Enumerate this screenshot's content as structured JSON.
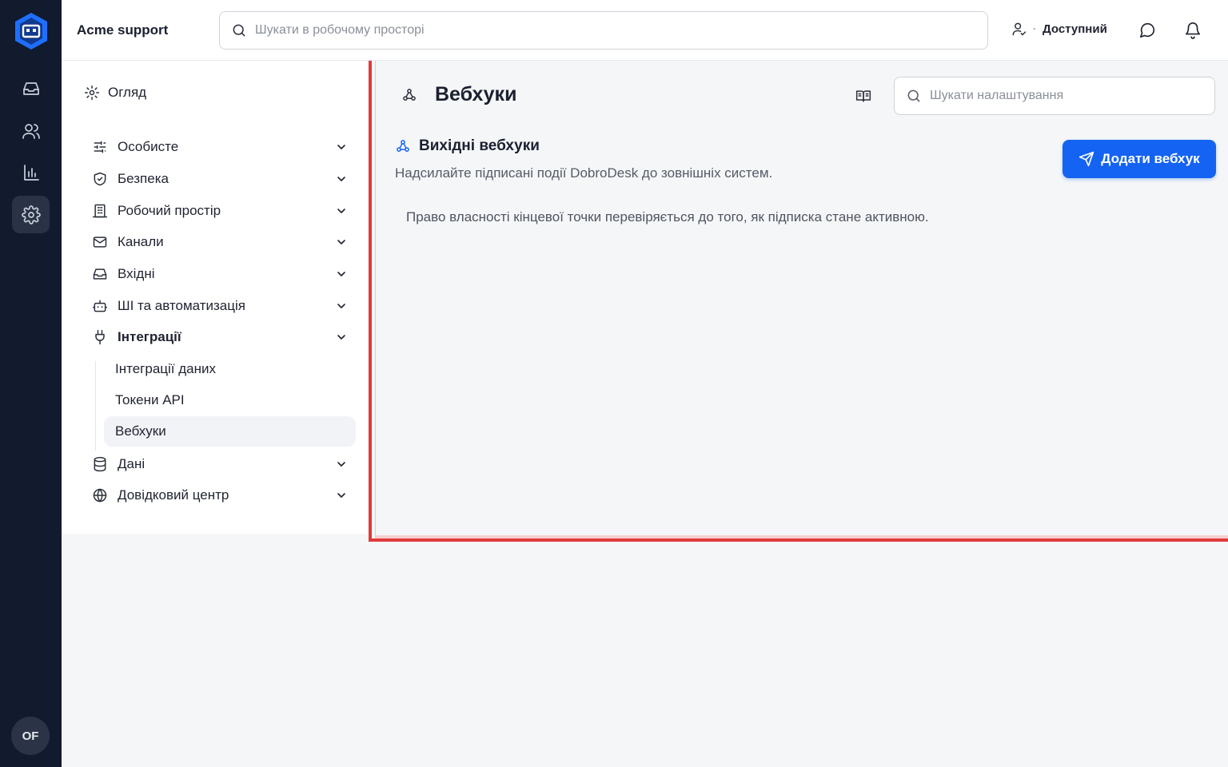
{
  "brand": "Acme support",
  "global_search": {
    "placeholder": "Шукати в робочому просторі"
  },
  "status": {
    "label": "Доступний"
  },
  "user": {
    "initials": "OF"
  },
  "settings_nav": {
    "overview": "Огляд",
    "groups": [
      {
        "label": "Особисте",
        "icon": "sliders-icon"
      },
      {
        "label": "Безпека",
        "icon": "shield-icon"
      },
      {
        "label": "Робочий простір",
        "icon": "building-icon"
      },
      {
        "label": "Канали",
        "icon": "mail-icon"
      },
      {
        "label": "Вхідні",
        "icon": "inbox-icon"
      },
      {
        "label": "ШІ та автоматизація",
        "icon": "bot-icon"
      },
      {
        "label": "Інтеграції",
        "icon": "plug-icon"
      },
      {
        "label": "Дані",
        "icon": "database-icon"
      },
      {
        "label": "Довідковий центр",
        "icon": "globe-icon"
      }
    ],
    "integrations_sub": [
      "Інтеграції даних",
      "Токени API",
      "Вебхуки"
    ]
  },
  "page": {
    "title": "Вебхуки",
    "search_placeholder": "Шукати налаштування",
    "section_title": "Вихідні вебхуки",
    "section_desc": "Надсилайте підписані події DobroDesk до зовнішніх систем.",
    "add_button": "Додати вебхук",
    "note": "Право власності кінцевої точки перевіряється до того, як підписка стане активною."
  },
  "colors": {
    "accent": "#1463f3",
    "rail": "#121a2e",
    "highlight": "#e03a3a"
  }
}
